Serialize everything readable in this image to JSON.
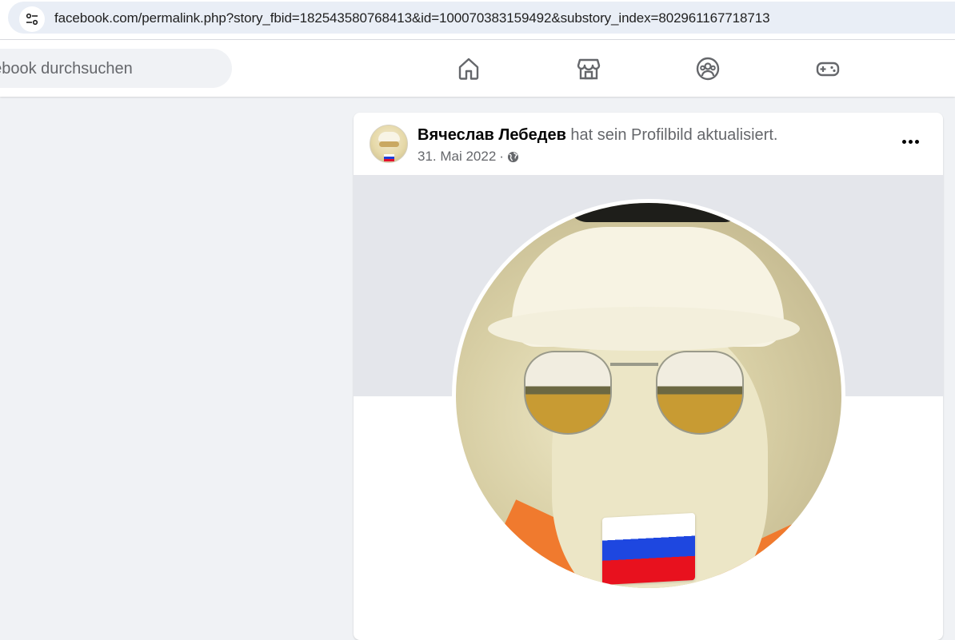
{
  "browser": {
    "url": "facebook.com/permalink.php?story_fbid=182543580768413&id=100070383159492&substory_index=802961167718713"
  },
  "header": {
    "search_placeholder": "acebook durchsuchen",
    "nav": [
      {
        "name": "home-icon"
      },
      {
        "name": "marketplace-icon"
      },
      {
        "name": "groups-icon"
      },
      {
        "name": "gaming-icon"
      }
    ]
  },
  "post": {
    "author": "Вячеслав Лебедев",
    "action": " hat sein Profilbild aktualisiert.",
    "date": "31. Mai 2022",
    "separator": "·",
    "audience_icon": "globe-icon"
  },
  "colors": {
    "background": "#f0f2f5",
    "card": "#ffffff",
    "secondary_text": "#65676b",
    "cover": "#e4e6eb"
  }
}
